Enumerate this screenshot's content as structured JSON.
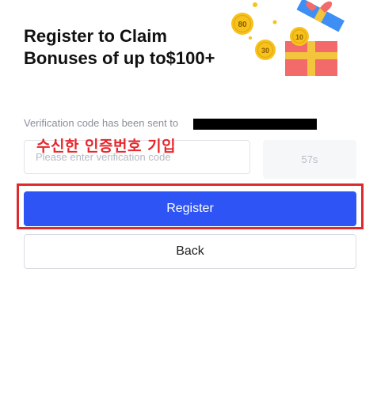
{
  "header": {
    "title_line1": "Register to Claim",
    "title_line2": "Bonuses of up to$100+",
    "coins": [
      "80",
      "30",
      "10"
    ]
  },
  "verification": {
    "sent_text": "Verification code has been sent to",
    "input_placeholder": "Please enter verification code",
    "input_value": "",
    "countdown": "57s"
  },
  "annotation": {
    "text": "수신한 인증번호 기입",
    "color": "#e8262b"
  },
  "actions": {
    "register_label": "Register",
    "back_label": "Back"
  },
  "colors": {
    "primary": "#2f54f5",
    "highlight": "#dd2a2f",
    "coin": "#f7c21c",
    "gift_box": "#f26a6a",
    "gift_lid": "#3d8ef5",
    "ribbon": "#f3c53c"
  }
}
